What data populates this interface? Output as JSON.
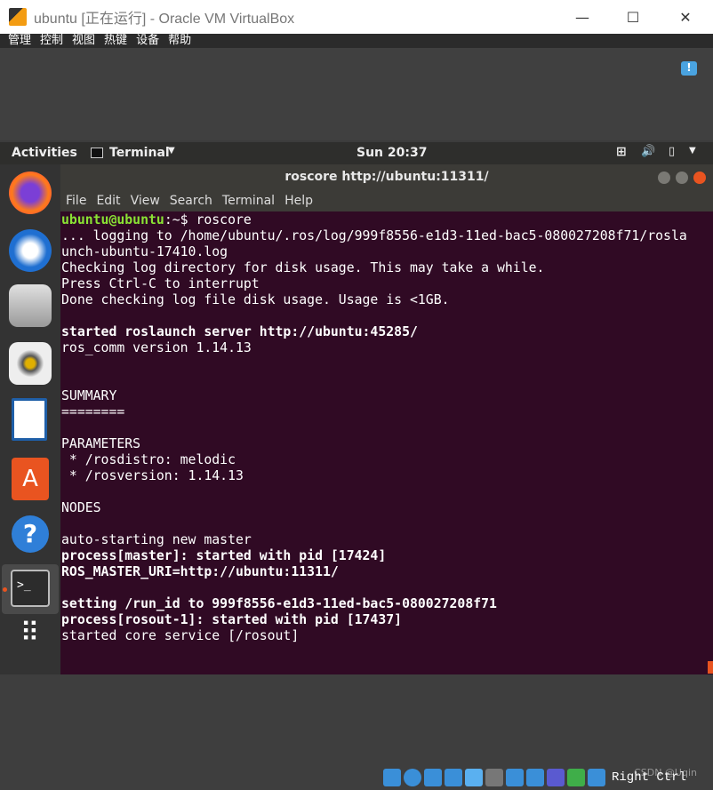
{
  "window": {
    "title": "ubuntu [正在运行] - Oracle VM VirtualBox",
    "minimize": "—",
    "maximize": "☐",
    "close": "✕"
  },
  "vm_menu": [
    "管理",
    "控制",
    "视图",
    "热键",
    "设备",
    "帮助"
  ],
  "topbar": {
    "activities": "Activities",
    "app": "Terminal",
    "clock": "Sun 20:37"
  },
  "dock": [
    "firefox-icon",
    "thunderbird-icon",
    "files-icon",
    "rhythmbox-icon",
    "libreoffice-writer-icon",
    "software-icon",
    "help-icon",
    "terminal-icon",
    "show-apps-icon"
  ],
  "terminal": {
    "title": "roscore http://ubuntu:11311/",
    "menu": [
      "File",
      "Edit",
      "View",
      "Search",
      "Terminal",
      "Help"
    ],
    "prompt_user": "ubuntu@ubuntu",
    "prompt_rest": ":~$ roscore",
    "lines": [
      {
        "t": "... logging to /home/ubuntu/.ros/log/999f8556-e1d3-11ed-bac5-080027208f71/rosla",
        "b": false
      },
      {
        "t": "unch-ubuntu-17410.log",
        "b": false
      },
      {
        "t": "Checking log directory for disk usage. This may take a while.",
        "b": false
      },
      {
        "t": "Press Ctrl-C to interrupt",
        "b": false
      },
      {
        "t": "Done checking log file disk usage. Usage is <1GB.",
        "b": false
      },
      {
        "t": "",
        "b": false
      },
      {
        "t": "started roslaunch server http://ubuntu:45285/",
        "b": true
      },
      {
        "t": "ros_comm version 1.14.13",
        "b": false
      },
      {
        "t": "",
        "b": false
      },
      {
        "t": "",
        "b": false
      },
      {
        "t": "SUMMARY",
        "b": false
      },
      {
        "t": "========",
        "b": false
      },
      {
        "t": "",
        "b": false
      },
      {
        "t": "PARAMETERS",
        "b": false
      },
      {
        "t": " * /rosdistro: melodic",
        "b": false
      },
      {
        "t": " * /rosversion: 1.14.13",
        "b": false
      },
      {
        "t": "",
        "b": false
      },
      {
        "t": "NODES",
        "b": false
      },
      {
        "t": "",
        "b": false
      },
      {
        "t": "auto-starting new master",
        "b": false
      },
      {
        "t": "process[master]: started with pid [17424]",
        "b": true
      },
      {
        "t": "ROS_MASTER_URI=http://ubuntu:11311/",
        "b": true
      },
      {
        "t": "",
        "b": false
      },
      {
        "t": "setting /run_id to 999f8556-e1d3-11ed-bac5-080027208f71",
        "b": true
      },
      {
        "t": "process[rosout-1]: started with pid [17437]",
        "b": true
      },
      {
        "t": "started core service [/rosout]",
        "b": false
      }
    ]
  },
  "statusbar": {
    "host_key": "Right Ctrl",
    "watermark": "CSDN @Uqin"
  },
  "colors": {
    "terminal_bg": "#300a24",
    "prompt_green": "#8ae234",
    "close_orange": "#e95420"
  }
}
